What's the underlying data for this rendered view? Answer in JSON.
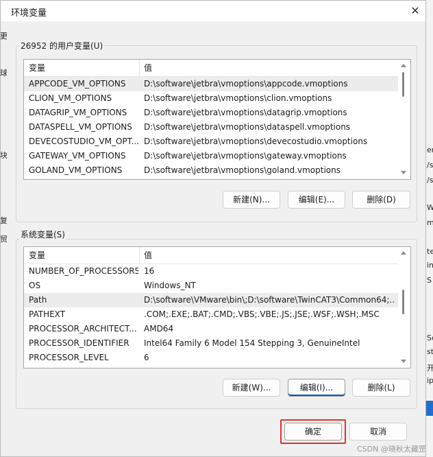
{
  "background": {
    "left_fragments": [
      "更",
      "球",
      "块",
      "复",
      "贸"
    ],
    "right_fragments": [
      "er",
      "/s",
      "/s",
      "W",
      "m",
      "te",
      "in",
      "S",
      "Sc",
      "st",
      "开",
      "ip",
      "oi"
    ]
  },
  "dialog": {
    "title": "环境变量",
    "close_symbol": "✕"
  },
  "user_vars": {
    "group_label": "26952 的用户变量(U)",
    "columns": [
      "变量",
      "值"
    ],
    "selected_index": 0,
    "rows": [
      {
        "name": "APPCODE_VM_OPTIONS",
        "value": "D:\\software\\jetbra\\vmoptions\\appcode.vmoptions"
      },
      {
        "name": "CLION_VM_OPTIONS",
        "value": "D:\\software\\jetbra\\vmoptions\\clion.vmoptions"
      },
      {
        "name": "DATAGRIP_VM_OPTIONS",
        "value": "D:\\software\\jetbra\\vmoptions\\datagrip.vmoptions"
      },
      {
        "name": "DATASPELL_VM_OPTIONS",
        "value": "D:\\software\\jetbra\\vmoptions\\dataspell.vmoptions"
      },
      {
        "name": "DEVECOSTUDIO_VM_OPT...",
        "value": "D:\\software\\jetbra\\vmoptions\\devecostudio.vmoptions"
      },
      {
        "name": "GATEWAY_VM_OPTIONS",
        "value": "D:\\software\\jetbra\\vmoptions\\gateway.vmoptions"
      },
      {
        "name": "GOLAND_VM_OPTIONS",
        "value": "D:\\software\\jetbra\\vmoptions\\goland.vmoptions"
      }
    ],
    "buttons": {
      "new": "新建(N)...",
      "edit": "编辑(E)...",
      "delete": "删除(D)"
    }
  },
  "system_vars": {
    "group_label": "系统变量(S)",
    "columns": [
      "变量",
      "值"
    ],
    "selected_index": 2,
    "rows": [
      {
        "name": "NUMBER_OF_PROCESSORS",
        "value": "16"
      },
      {
        "name": "OS",
        "value": "Windows_NT"
      },
      {
        "name": "Path",
        "value": "D:\\software\\VMware\\bin\\;D:\\software\\TwinCAT3\\Common64;..."
      },
      {
        "name": "PATHEXT",
        "value": ".COM;.EXE;.BAT;.CMD;.VBS;.VBE;.JS;.JSE;.WSF;.WSH;.MSC"
      },
      {
        "name": "PROCESSOR_ARCHITECT...",
        "value": "AMD64"
      },
      {
        "name": "PROCESSOR_IDENTIFIER",
        "value": "Intel64 Family 6 Model 154 Stepping 3, GenuineIntel"
      },
      {
        "name": "PROCESSOR_LEVEL",
        "value": "6"
      }
    ],
    "buttons": {
      "new": "新建(W)...",
      "edit": "编辑(I)...",
      "delete": "删除(L)"
    }
  },
  "footer": {
    "ok": "确定",
    "cancel": "取消"
  },
  "watermark": "CSDN @晓秋太藏罡",
  "colors": {
    "highlight": "#e0322f",
    "focus_accent": "#005fb8",
    "selected_row": "#ececec"
  }
}
